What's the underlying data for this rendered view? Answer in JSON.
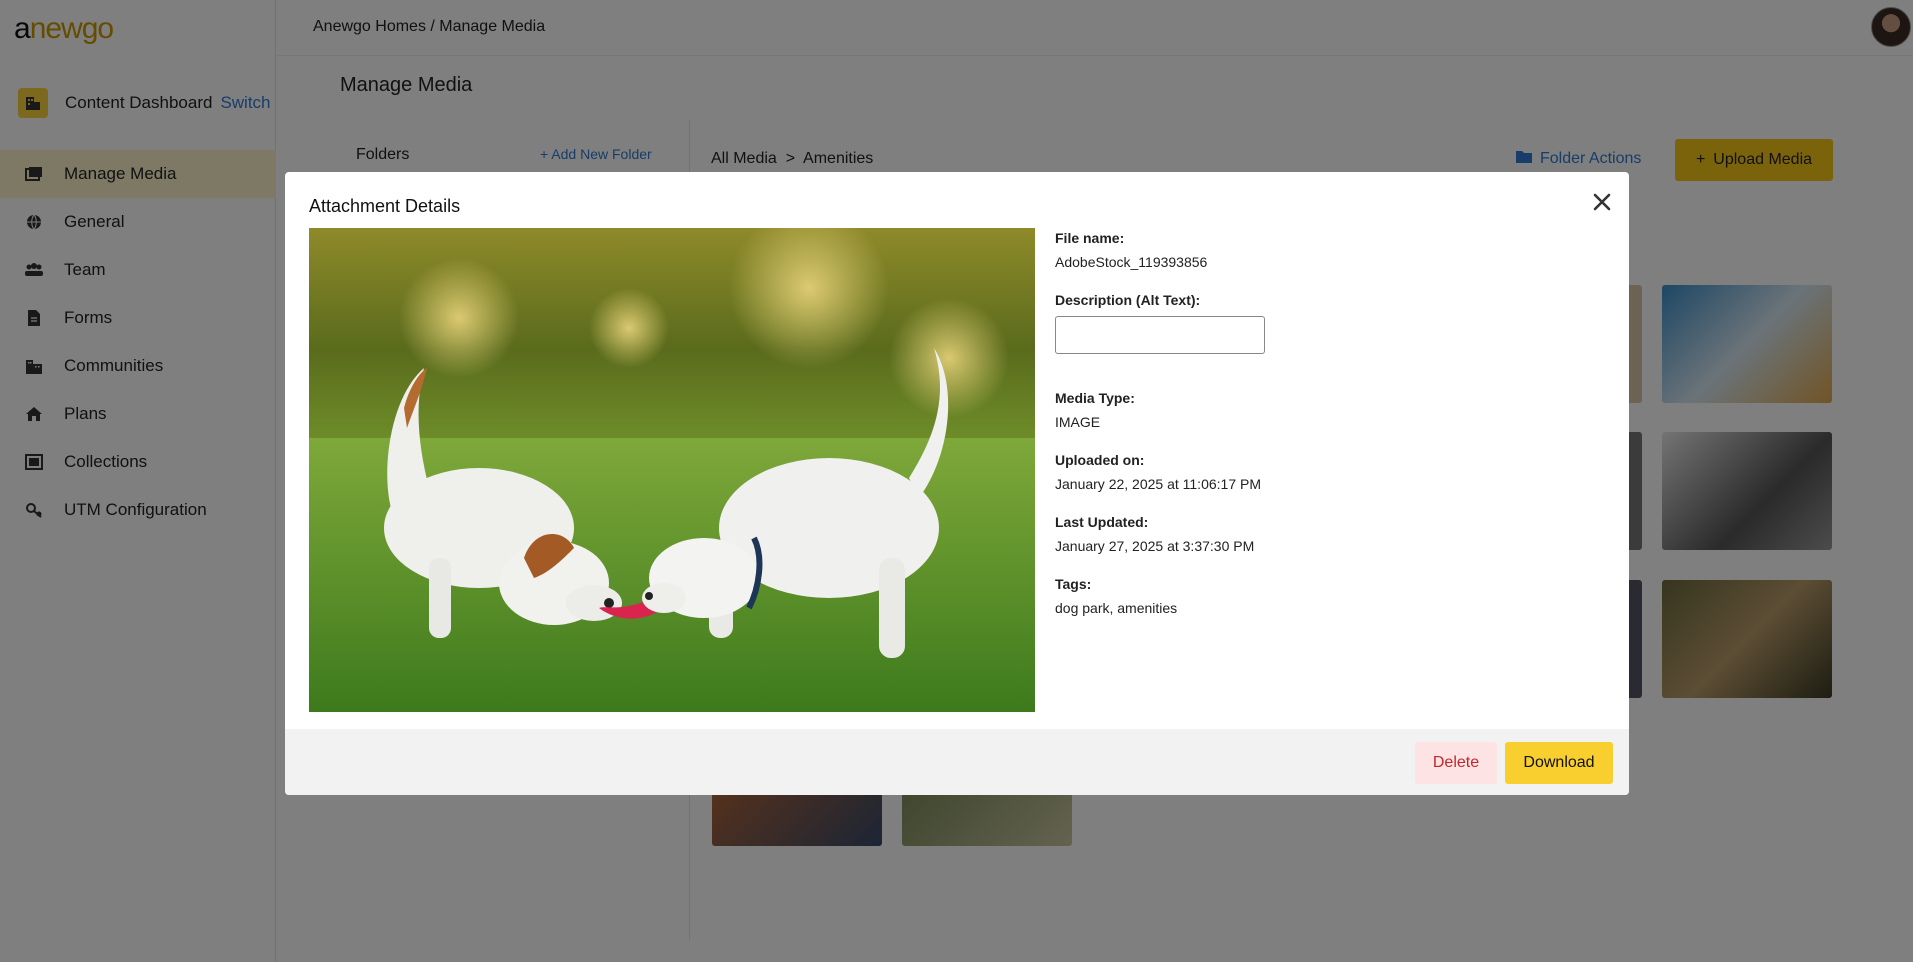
{
  "app": {
    "logo_prefix": "a",
    "logo_rest": "newgo"
  },
  "workspace": {
    "label": "Content Dashboard",
    "switch_label": "Switch"
  },
  "sidebar": {
    "items": [
      {
        "label": "Manage Media",
        "icon": "media-icon",
        "active": true
      },
      {
        "label": "General",
        "icon": "globe-icon",
        "active": false
      },
      {
        "label": "Team",
        "icon": "team-icon",
        "active": false
      },
      {
        "label": "Forms",
        "icon": "document-icon",
        "active": false
      },
      {
        "label": "Communities",
        "icon": "building-icon",
        "active": false
      },
      {
        "label": "Plans",
        "icon": "home-icon",
        "active": false
      },
      {
        "label": "Collections",
        "icon": "collection-icon",
        "active": false
      },
      {
        "label": "UTM Configuration",
        "icon": "utm-icon",
        "active": false
      }
    ]
  },
  "header": {
    "breadcrumb": "Anewgo Homes / Manage Media"
  },
  "main": {
    "title": "Manage Media",
    "folders_title": "Folders",
    "add_folder_label": "Add New Folder",
    "media_breadcrumb": "All Media  >  Amenities",
    "folder_actions_label": "Folder Actions",
    "upload_label": "Upload Media"
  },
  "modal": {
    "title": "Attachment Details",
    "file_name_label": "File name:",
    "file_name": "AdobeStock_119393856",
    "alt_text_label": "Description (Alt Text):",
    "alt_text_value": "",
    "media_type_label": "Media Type:",
    "media_type": "IMAGE",
    "uploaded_label": "Uploaded on:",
    "uploaded_value": "January 22, 2025 at 11:06:17 PM",
    "updated_label": "Last Updated:",
    "updated_value": "January 27, 2025 at 3:37:30 PM",
    "tags_label": "Tags:",
    "tags_value": "dog park, amenities",
    "delete_label": "Delete",
    "download_label": "Download"
  },
  "colors": {
    "accent": "#f8cf2f",
    "link": "#2f7ad0",
    "danger": "#c2272d"
  }
}
